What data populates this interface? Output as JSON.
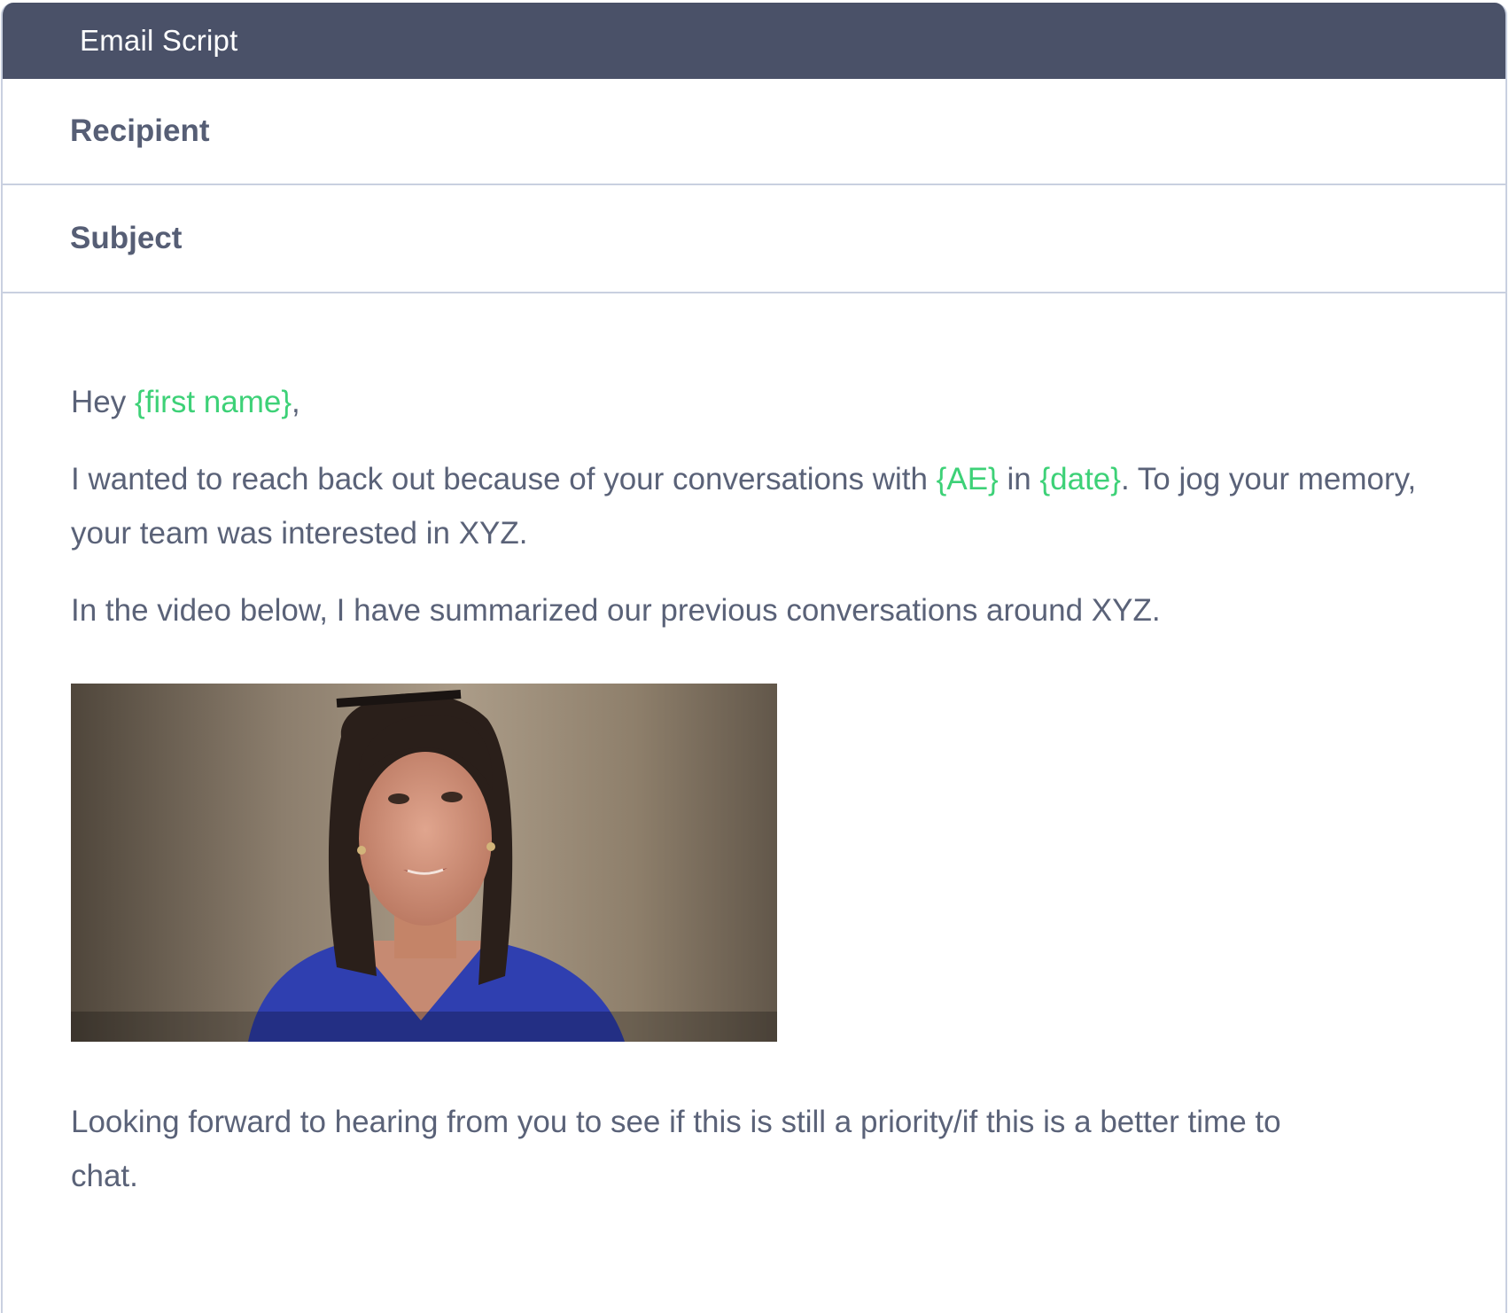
{
  "window": {
    "title": "Email Script"
  },
  "fields": {
    "recipient_label": "Recipient",
    "subject_label": "Subject"
  },
  "email": {
    "greeting_prefix": "Hey ",
    "greeting_token": "{first name}",
    "greeting_suffix": ",",
    "p1_a": "I wanted to reach back out because of your conversations with ",
    "p1_token_ae": "{AE}",
    "p1_b": " in ",
    "p1_token_date": "{date}",
    "p1_c": ". To jog your memory, your team was interested in XYZ.",
    "p2": "In the video below, I have summarized our previous conversations around XYZ.",
    "closing": "Looking forward  to hearing from you to see if this is still a priority/if this is a better time to chat."
  },
  "colors": {
    "header_bg": "#4a5168",
    "token": "#3dd177",
    "text": "#5a6278",
    "divider": "#c9d0e0"
  },
  "video": {
    "subject": "woman-speaking-video-thumbnail"
  }
}
